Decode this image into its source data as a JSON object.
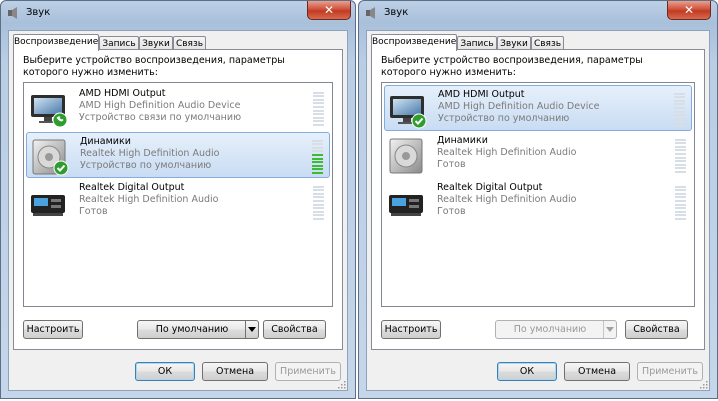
{
  "left": {
    "title": "Звук",
    "close_label": "✕",
    "tabs": [
      {
        "label": "Воспроизведение"
      },
      {
        "label": "Запись"
      },
      {
        "label": "Звуки"
      },
      {
        "label": "Связь"
      }
    ],
    "instruction": "Выберите устройство воспроизведения, параметры которого нужно изменить:",
    "devices": [
      {
        "name": "AMD HDMI Output",
        "driver": "AMD High Definition Audio Device",
        "status": "Устройство связи по умолчанию",
        "icon": "monitor-icon",
        "badge": "phone-check-icon",
        "level": 0
      },
      {
        "name": "Динамики",
        "driver": "Realtek High Definition Audio",
        "status": "Устройство по умолчанию",
        "icon": "speaker-icon",
        "badge": "check-icon",
        "level": 0.6
      },
      {
        "name": "Realtek Digital Output",
        "driver": "Realtek High Definition Audio",
        "status": "Готов",
        "icon": "digital-output-icon",
        "level": 0
      }
    ],
    "buttons": {
      "configure": "Настроить",
      "default": "По умолчанию",
      "properties": "Свойства",
      "ok": "ОК",
      "cancel": "Отмена",
      "apply": "Применить"
    }
  },
  "right": {
    "title": "Звук",
    "close_label": "✕",
    "tabs": [
      {
        "label": "Воспроизведение"
      },
      {
        "label": "Запись"
      },
      {
        "label": "Звуки"
      },
      {
        "label": "Связь"
      }
    ],
    "instruction": "Выберите устройство воспроизведения, параметры которого нужно изменить:",
    "devices": [
      {
        "name": "AMD HDMI Output",
        "driver": "AMD High Definition Audio Device",
        "status": "Устройство по умолчанию",
        "icon": "monitor-icon",
        "badge": "check-icon",
        "level": 0
      },
      {
        "name": "Динамики",
        "driver": "Realtek High Definition Audio",
        "status": "Готов",
        "icon": "speaker-icon",
        "level": 0
      },
      {
        "name": "Realtek Digital Output",
        "driver": "Realtek High Definition Audio",
        "status": "Готов",
        "icon": "digital-output-icon",
        "level": 0
      }
    ],
    "buttons": {
      "configure": "Настроить",
      "default": "По умолчанию",
      "properties": "Свойства",
      "ok": "ОК",
      "cancel": "Отмена",
      "apply": "Применить"
    }
  },
  "colors": {
    "selection": "#c9dcf3",
    "meter_on": "#3dbb35",
    "meter_off": "#d8dee5",
    "close": "#c13b22"
  }
}
